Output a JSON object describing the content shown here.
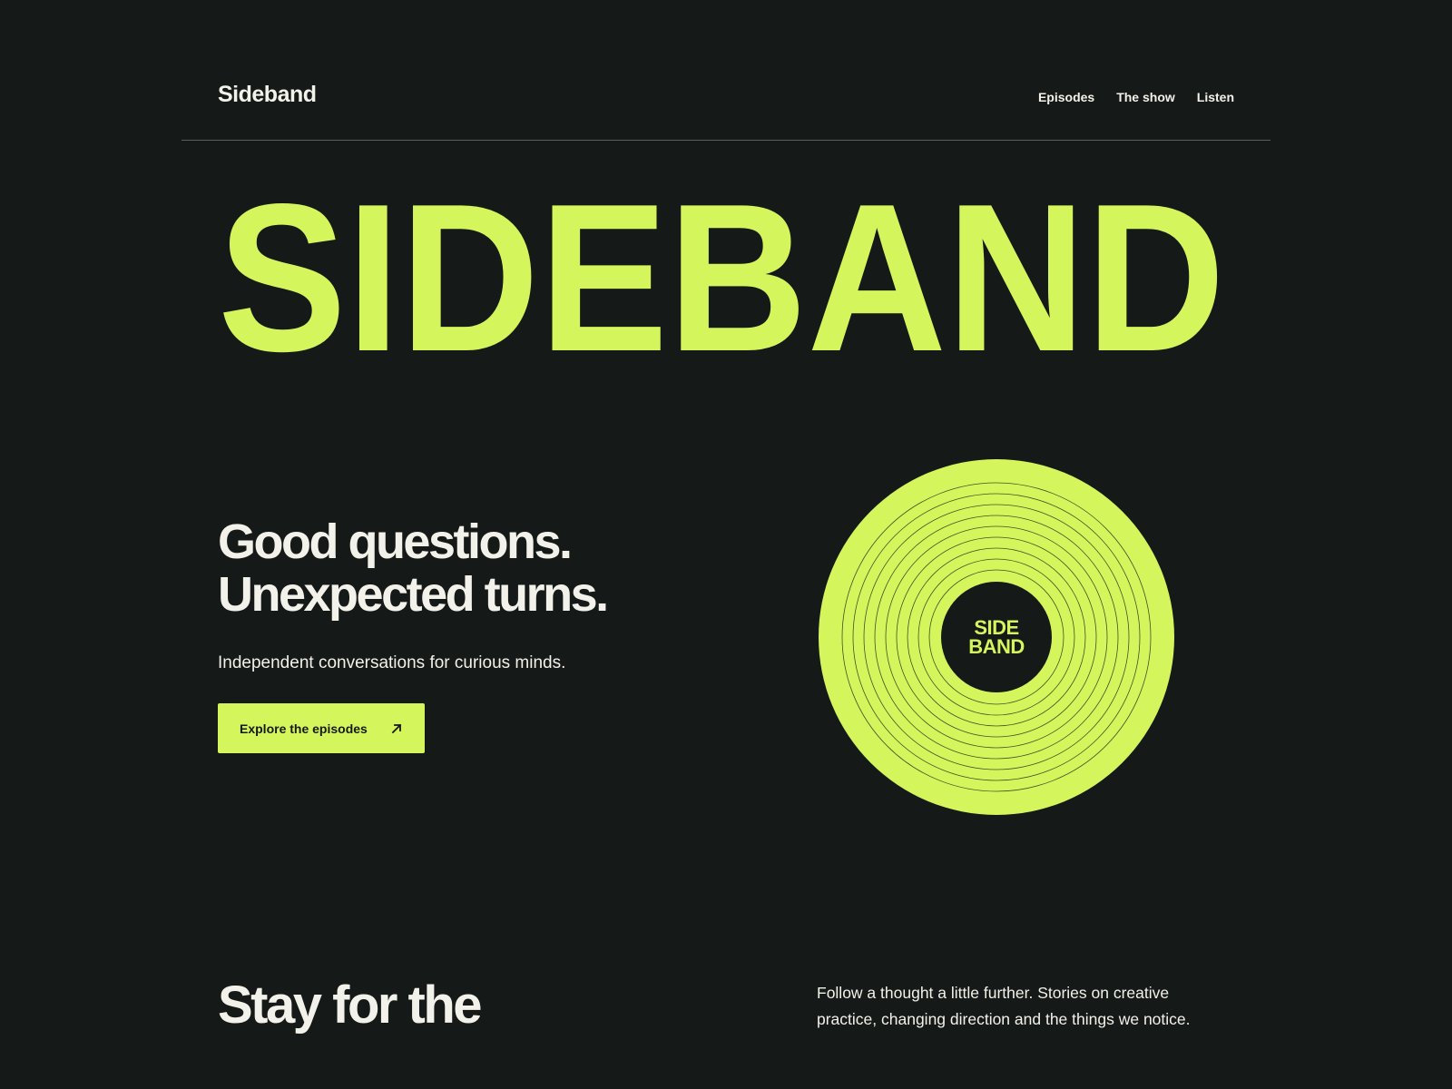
{
  "header": {
    "logo": "Sideband",
    "nav": [
      "Episodes",
      "The show",
      "Listen"
    ]
  },
  "hero": {
    "wordmark": "SIDEBAND",
    "headline": [
      "Good questions.",
      "Unexpected turns."
    ],
    "subtitle": "Independent conversations for curious minds.",
    "cta_label": "Explore the episodes",
    "cta_icon": "arrow-up-right-icon"
  },
  "record": {
    "label_line1": "SIDE",
    "label_line2": "BAND"
  },
  "section": {
    "heading": "Stay for the",
    "text": "Follow a thought a little further. Stories on creative practice, changing direction and the things we notice."
  },
  "colors": {
    "background": "#151917",
    "accent": "#d5f55c",
    "text": "#f2f1ea"
  }
}
